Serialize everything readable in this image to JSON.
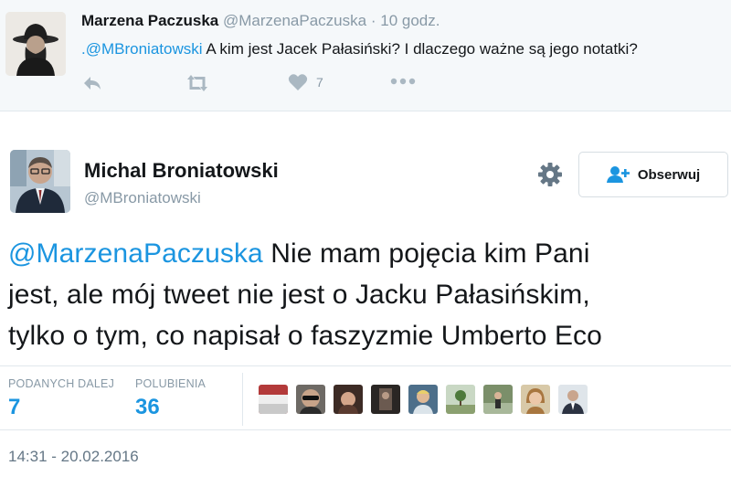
{
  "reply": {
    "author_name": "Marzena Paczuska",
    "author_handle": "@MarzenaPaczuska",
    "separator": "·",
    "time": "10 godz.",
    "mention": ".@MBroniatowski",
    "text": "A kim jest Jacek Pałasiński? I dlaczego ważne są jego notatki?",
    "like_count": "7",
    "icons": [
      "reply-icon",
      "retweet-icon",
      "heart-icon",
      "more-icon"
    ]
  },
  "main": {
    "author_name": "Michal Broniatowski",
    "author_handle": "@MBroniatowski",
    "follow_label": "Obserwuj",
    "mention": "@MarzenaPaczuska",
    "text_line1": "Nie mam pojęcia kim Pani",
    "text_line2": "jest, ale mój tweet nie jest o Jacku Pałasińskim,",
    "text_line3": "tylko o tym, co napisał o faszyzmie Umberto Eco",
    "retweets_label": "PODANYCH DALEJ",
    "retweets_count": "7",
    "likes_label": "POLUBIENIA",
    "likes_count": "36",
    "timestamp": "14:31 - 20.02.2016",
    "icons": [
      "gear-icon",
      "follow-user-icon"
    ]
  },
  "colors": {
    "link": "#1b95e0",
    "muted": "#8899a6",
    "icon_gray": "#aab8c2",
    "border": "#e1e8ed",
    "reply_bg": "#f5f8fa"
  }
}
